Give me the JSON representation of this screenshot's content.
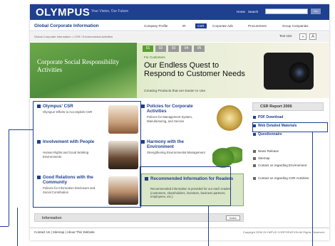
{
  "header": {
    "logo": "OLYMPUS",
    "tagline": "Your Vision, Our Future",
    "home": "Home",
    "search": "Search",
    "go": "Go"
  },
  "nav": {
    "site_title": "Global Corporate Information",
    "items": [
      "Company Profile",
      "IR",
      "CSR",
      "Corporate Ads",
      "Procurement",
      "Group Companies"
    ],
    "active_index": 2
  },
  "breadcrumb": "Global Corporate Information > CSR / Environmental Activities",
  "text_size": {
    "label": "Text size",
    "small": "A",
    "large": "A"
  },
  "hero": {
    "left_text": "Corporate Social Responsibility Activities",
    "tabs": [
      "01",
      "02",
      "03",
      "04",
      "05"
    ],
    "active_tab": 0,
    "category": "For Customers",
    "headline": "Our Endless Quest to Respond to Customer Needs",
    "sub": "Creating Products that are Easier to Use"
  },
  "cards": [
    {
      "title": "Olympus' CSR",
      "text": "Olympus' Efforts to Accomplish CSR",
      "image": "children-photo"
    },
    {
      "title": "Policies for Corporate Activities",
      "text": "Policies for Management System, Manufacturing, and Service",
      "image": "compass-photo"
    },
    {
      "title": "Involvement with People",
      "text": "Human Rights and Good Working Environments",
      "image": "people-photo"
    },
    {
      "title": "Harmony with the Environment",
      "text": "Strengthening Environmental Management",
      "image": "leaves-photo"
    },
    {
      "title": "Good Relations with the Community",
      "text": "Policies for Information Disclosure and Social Contribution",
      "image": "girl-photo"
    },
    {
      "title": "Recommended Information for Readers",
      "text": "Recommended information is provided for our each readers (customers, shareholders, investors, business partners, employees, etc.)",
      "image": ""
    }
  ],
  "information": {
    "label": "Information",
    "button": "Index"
  },
  "sidebar": {
    "report": "CSR Report 2006",
    "items": [
      "PDF Download",
      "Web Detailed Materials",
      "Questionnaire"
    ],
    "small_items": [
      "News Release",
      "Sitemap",
      "Contact us regarding Environment",
      "Contact us regarding CSR Activities"
    ]
  },
  "footer": {
    "links": "Contact Us | Sitemap | About This Website",
    "copyright": "Copyright 2006 OLYMPUS CORPORATION All Rights Reserved."
  }
}
